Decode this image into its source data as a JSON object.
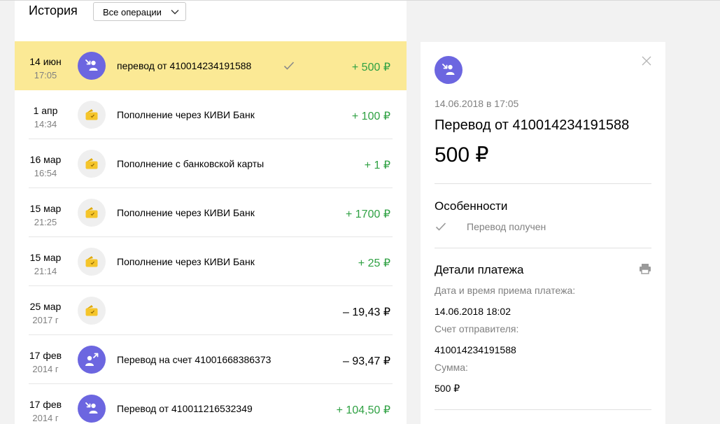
{
  "history": {
    "title": "История",
    "filter": {
      "label": "Все операции",
      "icon": "chevron-down-icon"
    },
    "rows": [
      {
        "date": "14 июн",
        "sub": "17:05",
        "icon": "incoming-transfer-icon",
        "description": "перевод от 410014234191588",
        "amount": "+ 500 ₽",
        "sign": "plus",
        "status_icon": "check-icon",
        "selected": true
      },
      {
        "date": "1 апр",
        "sub": "14:34",
        "icon": "wallet-icon",
        "description": "Пополнение через КИВИ Банк",
        "amount": "+ 100 ₽",
        "sign": "plus"
      },
      {
        "date": "16 мар",
        "sub": "16:54",
        "icon": "wallet-icon",
        "description": "Пополнение с банковской карты",
        "amount": "+ 1 ₽",
        "sign": "plus"
      },
      {
        "date": "15 мар",
        "sub": "21:25",
        "icon": "wallet-icon",
        "description": "Пополнение через КИВИ Банк",
        "amount": "+ 1700 ₽",
        "sign": "plus"
      },
      {
        "date": "15 мар",
        "sub": "21:14",
        "icon": "wallet-icon",
        "description": "Пополнение через КИВИ Банк",
        "amount": "+ 25 ₽",
        "sign": "plus"
      },
      {
        "date": "25 мар",
        "sub": "2017 г",
        "icon": "wallet-icon",
        "description": "",
        "amount": "– 19,43 ₽",
        "sign": "minus"
      },
      {
        "date": "17 фев",
        "sub": "2014 г",
        "icon": "outgoing-transfer-icon",
        "description": "Перевод на счет 41001668386373",
        "amount": "– 93,47 ₽",
        "sign": "minus"
      },
      {
        "date": "17 фев",
        "sub": "2014 г",
        "icon": "incoming-transfer-icon",
        "description": "Перевод от 410011216532349",
        "amount": "+ 104,50 ₽",
        "sign": "plus"
      }
    ]
  },
  "detail": {
    "date": "14.06.2018 в 17:05",
    "title": "Перевод от 410014234191588",
    "amount": "500 ₽",
    "features": {
      "heading": "Особенности",
      "item": "Перевод получен"
    },
    "payment": {
      "heading": "Детали платежа",
      "received_label": "Дата и время приема платежа:",
      "received_value": "14.06.2018 18:02",
      "sender_label": "Счет отправителя:",
      "sender_value": "410014234191588",
      "sum_label": "Сумма:",
      "sum_value": "500 ₽"
    }
  },
  "colors": {
    "accent_purple": "#6c66e0",
    "selected_row": "#fbe995",
    "positive_amount": "#2fa143",
    "wallet_yellow": "#f5c52a",
    "page_background": "#f2f2f2"
  }
}
